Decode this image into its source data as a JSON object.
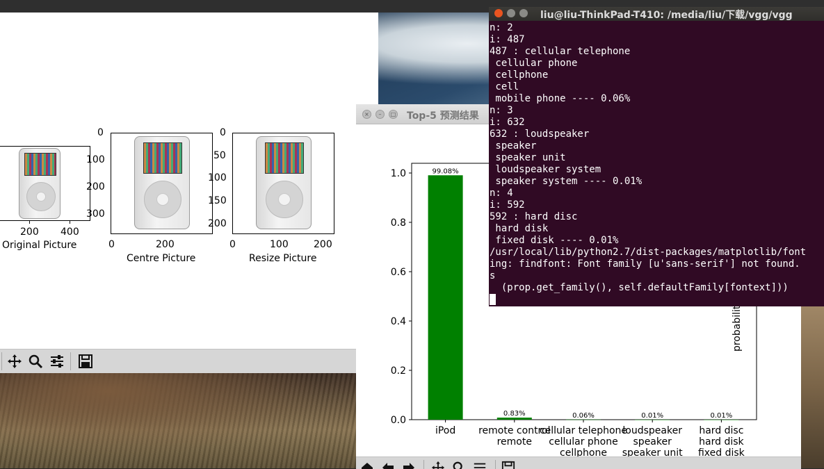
{
  "terminal": {
    "title": "liu@liu-ThinkPad-T410: /media/liu/下载/vgg/vgg",
    "lines": [
      "n: 2",
      "i: 487",
      "487 : cellular telephone",
      " cellular phone",
      " cellphone",
      " cell",
      " mobile phone ---- 0.06%",
      "n: 3",
      "i: 632",
      "632 : loudspeaker",
      " speaker",
      " speaker unit",
      " loudspeaker system",
      " speaker system ---- 0.01%",
      "n: 4",
      "i: 592",
      "592 : hard disc",
      " hard disk",
      " fixed disk ---- 0.01%",
      "/usr/local/lib/python2.7/dist-packages/matplotlib/font",
      "ing: findfont: Font family [u'sans-serif'] not found.",
      "s",
      "  (prop.get_family(), self.defaultFamily[fontext]))"
    ]
  },
  "figure1": {
    "captions": {
      "original": "Original Picture",
      "centre": "Centre Picture",
      "resize": "Resize Picture"
    },
    "original_xticks": [
      "200",
      "400"
    ],
    "centre_yticks": [
      "0",
      "100",
      "200",
      "300"
    ],
    "centre_xticks": [
      "0",
      "200"
    ],
    "resize_yticks": [
      "0",
      "50",
      "100",
      "150",
      "200"
    ],
    "resize_xticks": [
      "0",
      "100",
      "200"
    ],
    "toolbar_icons": [
      "pan-icon",
      "zoom-icon",
      "configure-icon",
      "save-icon"
    ]
  },
  "figure2": {
    "title": "Top-5 预测结果",
    "toolbar_icons": [
      "home-icon",
      "back-icon",
      "forward-icon",
      "pan-icon",
      "zoom-icon",
      "configure-icon",
      "save-icon"
    ]
  },
  "chart_data": {
    "type": "bar",
    "title": "",
    "xlabel": "",
    "ylabel": "probabilityit",
    "ylim": [
      0,
      1.0
    ],
    "yticks": [
      "0.0",
      "0.2",
      "0.4",
      "0.6",
      "0.8",
      "1.0"
    ],
    "categories": [
      [
        "iPod"
      ],
      [
        "remote control",
        "remote"
      ],
      [
        "cellular telephone",
        "cellular phone",
        "cellphone"
      ],
      [
        "loudspeaker",
        "speaker",
        "speaker unit"
      ],
      [
        "hard disc",
        "hard disk",
        "fixed disk"
      ]
    ],
    "values": [
      0.9908,
      0.0083,
      0.0006,
      0.0001,
      0.0001
    ],
    "value_labels": [
      "99.08%",
      "0.83%",
      "0.06%",
      "0.01%",
      "0.01%"
    ],
    "bar_color": "#008000"
  }
}
